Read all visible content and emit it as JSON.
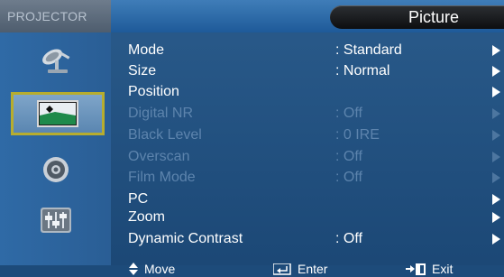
{
  "header": {
    "brand": "PROJECTOR",
    "title": "Picture"
  },
  "sidebar": {
    "items": [
      {
        "icon": "satellite-dish-icon"
      },
      {
        "icon": "picture-icon",
        "selected": true
      },
      {
        "icon": "gear-icon"
      },
      {
        "icon": "sliders-icon"
      }
    ]
  },
  "menu": {
    "rows": [
      {
        "label": "Mode",
        "value": ": Standard",
        "enabled": true,
        "arrow": true
      },
      {
        "label": "Size",
        "value": ": Normal",
        "enabled": true,
        "arrow": true
      },
      {
        "label": "Position",
        "value": "",
        "enabled": true,
        "arrow": true
      },
      {
        "label": "Digital NR",
        "value": ": Off",
        "enabled": false,
        "arrow": true
      },
      {
        "label": "Black Level",
        "value": ": 0 IRE",
        "enabled": false,
        "arrow": true
      },
      {
        "label": "Overscan",
        "value": ": Off",
        "enabled": false,
        "arrow": true
      },
      {
        "label": "Film Mode",
        "value": ": Off",
        "enabled": false,
        "arrow": true
      },
      {
        "label": "PC",
        "value": "",
        "enabled": true,
        "arrow": true
      },
      {
        "label": "Zoom",
        "value": "",
        "enabled": true,
        "arrow": true
      },
      {
        "label": "Dynamic Contrast",
        "value": ": Off",
        "enabled": true,
        "arrow": true
      }
    ]
  },
  "footer": {
    "move_label": "Move",
    "enter_label": "Enter",
    "exit_label": "Exit"
  },
  "colors": {
    "background": "#1b4775",
    "disabled_text": "#5d84ad",
    "selection_border": "#b7ad2e"
  }
}
